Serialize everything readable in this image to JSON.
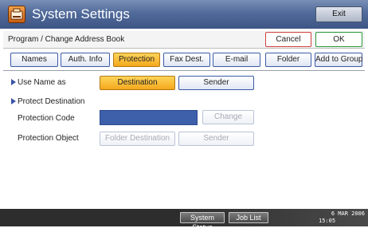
{
  "window": {
    "title": "System Settings",
    "exit_label": "Exit",
    "icon": "settings-app-icon"
  },
  "header": {
    "breadcrumb": "Program / Change Address Book",
    "cancel_label": "Cancel",
    "ok_label": "OK"
  },
  "tabs": [
    {
      "label": "Names",
      "active": false
    },
    {
      "label": "Auth. Info",
      "active": false
    },
    {
      "label": "Protection",
      "active": true
    },
    {
      "label": "Fax Dest.",
      "active": false
    },
    {
      "label": "E-mail",
      "active": false
    },
    {
      "label": "Folder",
      "active": false
    },
    {
      "label": "Add to Group",
      "active": false
    }
  ],
  "use_name_as": {
    "label": "Use Name as",
    "options": [
      {
        "label": "Destination",
        "selected": true
      },
      {
        "label": "Sender",
        "selected": false
      }
    ]
  },
  "protect_destination": {
    "label": "Protect Destination",
    "protection_code": {
      "label": "Protection Code",
      "value": "",
      "change_label": "Change",
      "change_enabled": false
    },
    "protection_object": {
      "label": "Protection Object",
      "options": [
        {
          "label": "Folder Destination",
          "enabled": false
        },
        {
          "label": "Sender",
          "enabled": false
        }
      ]
    }
  },
  "status_bar": {
    "system_status_label": "System Status",
    "job_list_label": "Job List",
    "date": "6 MAR 2006",
    "time": "15:05"
  },
  "colors": {
    "accent_selected": "#f4a81c",
    "title_bar": "#506a9a",
    "button_border": "#3b5aa8",
    "cancel_border": "#d24040",
    "ok_border": "#2a9a3a",
    "code_field": "#3e5fa9"
  }
}
